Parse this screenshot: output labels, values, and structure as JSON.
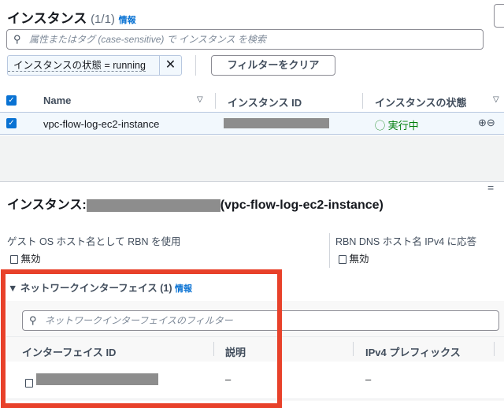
{
  "instances": {
    "title": "インスタンス",
    "count": "(1/1)",
    "info": "情報",
    "search_placeholder": "属性またはタグ (case-sensitive) で インスタンス を検索",
    "filter_token": "インスタンスの状態 = running",
    "clear_filters": "フィルターをクリア",
    "columns": [
      "Name",
      "インスタンス ID",
      "インスタンスの状態"
    ],
    "rows": [
      {
        "name": "vpc-flow-log-ec2-instance",
        "state": "実行中"
      }
    ]
  },
  "detail": {
    "title_prefix": "インスタンス:",
    "title_suffix": "(vpc-flow-log-ec2-instance)",
    "fields": [
      {
        "label": "ゲスト OS ホスト名として RBN を使用",
        "value": "無効"
      },
      {
        "label": "RBN DNS ホスト名 IPv4 に応答",
        "value": "無効"
      }
    ]
  },
  "eni": {
    "title": "ネットワークインターフェイス (1)",
    "info": "情報",
    "search_placeholder": "ネットワークインターフェイスのフィルター",
    "columns": [
      "インターフェイス ID",
      "説明",
      "IPv4 プレフィックス"
    ],
    "rows": [
      {
        "description": "–",
        "ipv4_prefix": "–"
      }
    ]
  },
  "colors": {
    "accent": "#0972d3",
    "success": "#037f0c",
    "highlight": "#e8412a"
  }
}
